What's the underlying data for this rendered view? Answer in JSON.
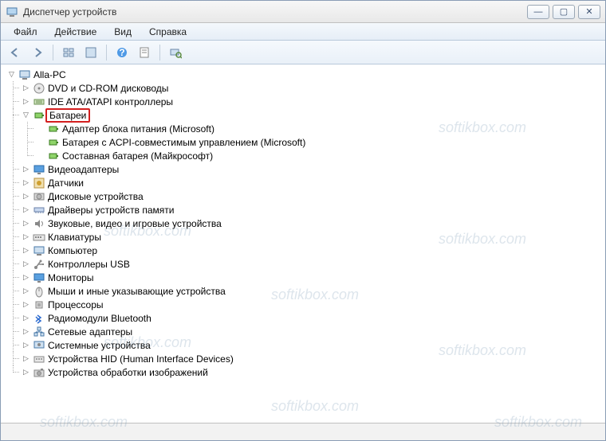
{
  "window": {
    "title": "Диспетчер устройств"
  },
  "menubar": [
    "Файл",
    "Действие",
    "Вид",
    "Справка"
  ],
  "toolbar_icons": [
    "back",
    "forward",
    "view-small",
    "view-large",
    "help",
    "properties",
    "scan"
  ],
  "winbtns": {
    "min": "—",
    "max": "▢",
    "close": "✕"
  },
  "tree": {
    "root": {
      "label": "Alla-PC",
      "expanded": true
    },
    "items": [
      {
        "label": "DVD и CD-ROM дисководы",
        "icon": "disc",
        "exp": "▷"
      },
      {
        "label": "IDE ATA/ATAPI контроллеры",
        "icon": "ide",
        "exp": "▷"
      },
      {
        "label": "Батареи",
        "icon": "battery",
        "exp": "▽",
        "highlight": true,
        "children": [
          {
            "label": "Адаптер блока питания (Microsoft)",
            "icon": "battery"
          },
          {
            "label": "Батарея с ACPI-совместимым управлением (Microsoft)",
            "icon": "battery"
          },
          {
            "label": "Составная батарея (Майкрософт)",
            "icon": "battery"
          }
        ]
      },
      {
        "label": "Видеоадаптеры",
        "icon": "display",
        "exp": "▷"
      },
      {
        "label": "Датчики",
        "icon": "sensor",
        "exp": "▷"
      },
      {
        "label": "Дисковые устройства",
        "icon": "hdd",
        "exp": "▷"
      },
      {
        "label": "Драйверы устройств памяти",
        "icon": "memory",
        "exp": "▷"
      },
      {
        "label": "Звуковые, видео и игровые устройства",
        "icon": "sound",
        "exp": "▷"
      },
      {
        "label": "Клавиатуры",
        "icon": "keyboard",
        "exp": "▷"
      },
      {
        "label": "Компьютер",
        "icon": "computer",
        "exp": "▷"
      },
      {
        "label": "Контроллеры USB",
        "icon": "usb",
        "exp": "▷"
      },
      {
        "label": "Мониторы",
        "icon": "monitor",
        "exp": "▷"
      },
      {
        "label": "Мыши и иные указывающие устройства",
        "icon": "mouse",
        "exp": "▷"
      },
      {
        "label": "Процессоры",
        "icon": "cpu",
        "exp": "▷"
      },
      {
        "label": "Радиомодули Bluetooth",
        "icon": "bluetooth",
        "exp": "▷"
      },
      {
        "label": "Сетевые адаптеры",
        "icon": "network",
        "exp": "▷"
      },
      {
        "label": "Системные устройства",
        "icon": "system",
        "exp": "▷"
      },
      {
        "label": "Устройства HID (Human Interface Devices)",
        "icon": "hid",
        "exp": "▷"
      },
      {
        "label": "Устройства обработки изображений",
        "icon": "imaging",
        "exp": "▷"
      }
    ]
  },
  "watermark": "softikbox.com"
}
